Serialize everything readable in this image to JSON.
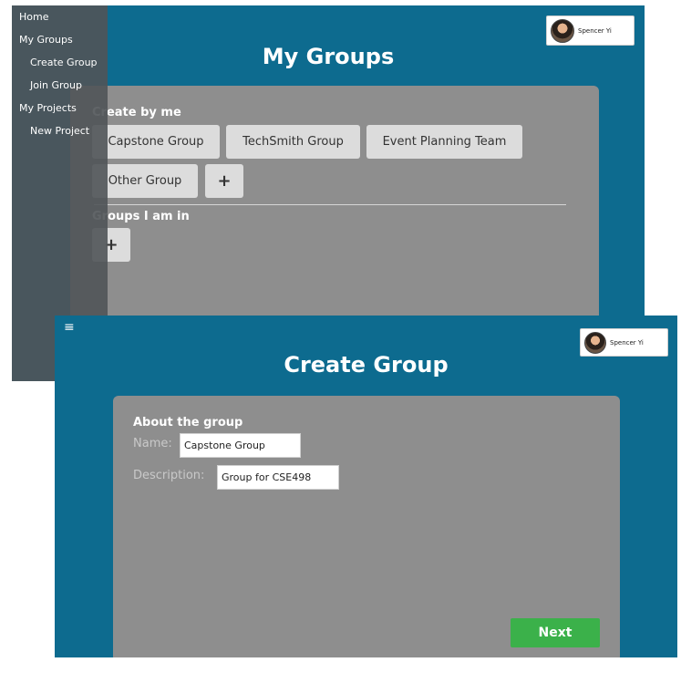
{
  "screen1": {
    "title": "My Groups",
    "sidebar": {
      "items": [
        {
          "label": "Home"
        },
        {
          "label": "My Groups"
        },
        {
          "label": "Create Group"
        },
        {
          "label": "Join Group"
        },
        {
          "label": "My Projects"
        },
        {
          "label": "New Project"
        }
      ]
    },
    "user": {
      "name": "Spencer Yi"
    },
    "created_label": "Create by me",
    "created_groups": [
      "Capstone Group",
      "TechSmith Group",
      "Event Planning Team",
      "Other Group"
    ],
    "add_label": "+",
    "member_label": "Groups I am in",
    "member_add_label": "+"
  },
  "screen2": {
    "menu_icon": "≡",
    "title": "Create Group",
    "user": {
      "name": "Spencer Yi"
    },
    "section_label": "About the group",
    "name_label": "Name:",
    "name_value": "Capstone Group",
    "description_label": "Description:",
    "description_value": "Group for CSE498",
    "next_label": "Next"
  }
}
